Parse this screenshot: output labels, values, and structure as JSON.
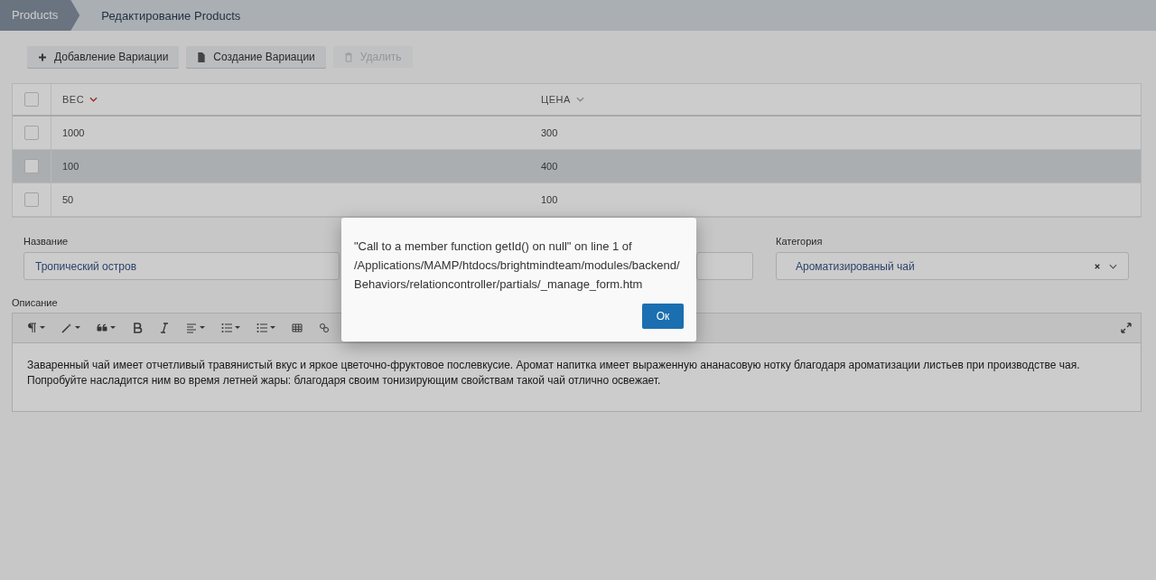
{
  "breadcrumbs": [
    {
      "label": "Products"
    },
    {
      "label": "Редактирование Products"
    }
  ],
  "toolbar": [
    {
      "label": "Добавление Вариации",
      "kind": "add",
      "disabled": false
    },
    {
      "label": "Создание Вариации",
      "kind": "create",
      "disabled": false
    },
    {
      "label": "Удалить",
      "kind": "delete",
      "disabled": true
    }
  ],
  "table": {
    "select_all": {
      "checked": false
    },
    "columns": [
      {
        "label": "ВЕС",
        "sorted": true
      },
      {
        "label": "ЦЕНА",
        "sorted": false
      }
    ],
    "rows": [
      {
        "cells": [
          "1000",
          "300"
        ],
        "checked": false,
        "selected": false
      },
      {
        "cells": [
          "100",
          "400"
        ],
        "checked": false,
        "selected": true
      },
      {
        "cells": [
          "50",
          "100"
        ],
        "checked": false,
        "selected": false
      }
    ]
  },
  "form": {
    "name": {
      "label": "Название",
      "value": "Тропический остров"
    },
    "category": {
      "label": "Категория",
      "value": "Ароматизированый чай"
    },
    "description": {
      "label": "Описание",
      "text": "Заваренный чай имеет отчетливый травянистый вкус и яркое цветочно-фруктовое послевкусие. Аромат напитка имеет выраженную ананасовую нотку благодаря ароматизации листьев при производстве чая. Попробуйте насладится ним во время летней жары: благодаря своим тонизирующим свойствам такой чай отлично освежает."
    }
  },
  "editor_toolbar": [
    {
      "kind": "paragraph"
    },
    {
      "kind": "style"
    },
    {
      "kind": "quote"
    },
    {
      "kind": "bold"
    },
    {
      "kind": "italic"
    },
    {
      "kind": "align"
    },
    {
      "kind": "ordered-list"
    },
    {
      "kind": "bullet-list"
    },
    {
      "kind": "table"
    },
    {
      "kind": "link"
    }
  ],
  "dialog": {
    "message_lines": [
      "\"Call to a member function getId() on null\" on line 1 of",
      "/Applications/MAMP/htdocs/brightmindteam/modules/backend/",
      "Behaviors/relationcontroller/partials/_manage_form.htm"
    ],
    "button": "Ок"
  }
}
